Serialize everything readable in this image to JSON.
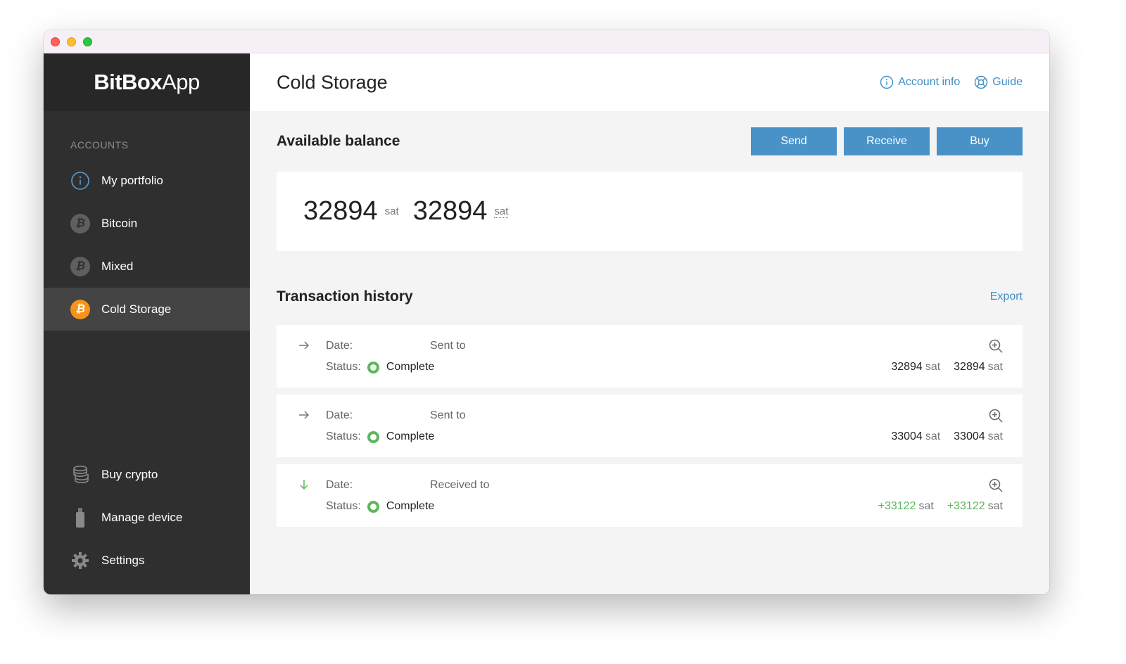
{
  "app": {
    "logo_bold": "BitBox",
    "logo_light": "App"
  },
  "sidebar": {
    "section_title": "ACCOUNTS",
    "items": [
      {
        "label": "My portfolio",
        "icon": "info-icon"
      },
      {
        "label": "Bitcoin",
        "icon": "bitcoin-icon"
      },
      {
        "label": "Mixed",
        "icon": "bitcoin-icon"
      },
      {
        "label": "Cold Storage",
        "icon": "bitcoin-icon",
        "active": true
      }
    ],
    "bottom_items": [
      {
        "label": "Buy crypto",
        "icon": "coins-icon"
      },
      {
        "label": "Manage device",
        "icon": "usb-device-icon"
      },
      {
        "label": "Settings",
        "icon": "gear-icon"
      }
    ]
  },
  "header": {
    "title": "Cold Storage",
    "account_info": "Account info",
    "guide": "Guide"
  },
  "balance": {
    "heading": "Available balance",
    "send": "Send",
    "receive": "Receive",
    "buy": "Buy",
    "amount": "32894",
    "unit": "sat",
    "amount_fiat": "32894",
    "unit_fiat": "sat"
  },
  "history": {
    "heading": "Transaction history",
    "export": "Export",
    "date_label": "Date:",
    "status_label": "Status:",
    "transactions": [
      {
        "direction": "sent",
        "type": "Sent to",
        "status": "Complete",
        "amount": "32894",
        "unit": "sat",
        "amount2": "32894",
        "unit2": "sat"
      },
      {
        "direction": "sent",
        "type": "Sent to",
        "status": "Complete",
        "amount": "33004",
        "unit": "sat",
        "amount2": "33004",
        "unit2": "sat"
      },
      {
        "direction": "received",
        "type": "Received to",
        "status": "Complete",
        "amount": "+33122",
        "unit": "sat",
        "amount2": "+33122",
        "unit2": "sat"
      }
    ]
  },
  "colors": {
    "accent": "#4892c8",
    "link": "#3f8fc5",
    "sidebar_bg": "#2f2f2f",
    "complete": "#5cb85c",
    "bitcoin_orange": "#f7931a"
  }
}
